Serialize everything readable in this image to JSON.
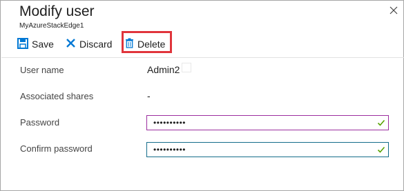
{
  "window": {
    "title": "Modify user",
    "subtitle": "MyAzureStackEdge1"
  },
  "toolbar": {
    "save_label": "Save",
    "discard_label": "Discard",
    "delete_label": "Delete"
  },
  "form": {
    "user_name": {
      "label": "User name",
      "value": "Admin2"
    },
    "associated_shares": {
      "label": "Associated shares",
      "value": "-"
    },
    "password": {
      "label": "Password",
      "value": "••••••••••"
    },
    "confirm_password": {
      "label": "Confirm password",
      "value": "••••••••••"
    }
  },
  "colors": {
    "accent": "#0078d4",
    "highlight": "#e0343b",
    "valid_check": "#57a300"
  },
  "icons": [
    "close-icon",
    "save-icon",
    "discard-icon",
    "delete-icon",
    "check-icon"
  ]
}
